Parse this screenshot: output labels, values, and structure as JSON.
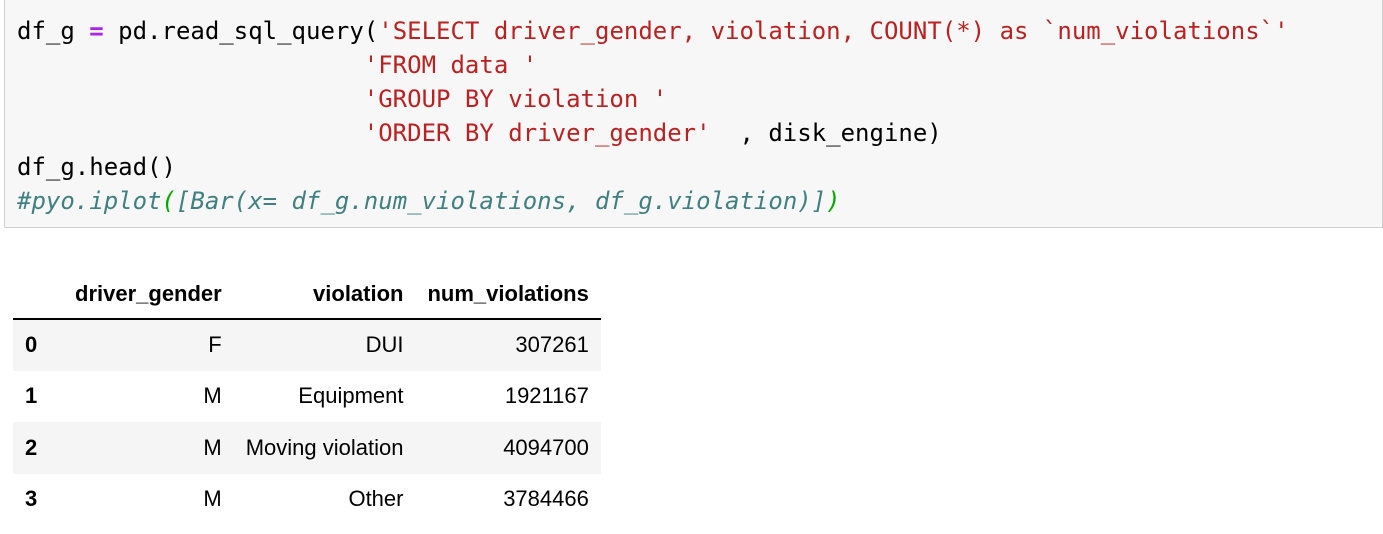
{
  "code_cell": {
    "lines": [
      {
        "parts": [
          {
            "t": "df_g ",
            "c": ""
          },
          {
            "t": "=",
            "c": "tok-op"
          },
          {
            "t": " pd.read_sql_query(",
            "c": ""
          },
          {
            "t": "'SELECT driver_gender, violation, COUNT(*) as `num_violations`'",
            "c": "tok-str"
          }
        ]
      },
      {
        "parts": [
          {
            "t": "                        ",
            "c": ""
          },
          {
            "t": "'FROM data '",
            "c": "tok-str"
          }
        ]
      },
      {
        "parts": [
          {
            "t": "                        ",
            "c": ""
          },
          {
            "t": "'GROUP BY violation '",
            "c": "tok-str"
          }
        ]
      },
      {
        "parts": [
          {
            "t": "                        ",
            "c": ""
          },
          {
            "t": "'ORDER BY driver_gender'",
            "c": "tok-str"
          },
          {
            "t": "  , disk_engine)",
            "c": ""
          }
        ]
      },
      {
        "parts": [
          {
            "t": "df_g.head()",
            "c": ""
          }
        ]
      },
      {
        "parts": [
          {
            "t": "#pyo.iplot",
            "c": "tok-comment"
          },
          {
            "t": "(",
            "c": "tok-comment tok-paren-green"
          },
          {
            "t": "[Bar(x= df_g.num_violations, df_g.violation)]",
            "c": "tok-comment"
          },
          {
            "t": ")",
            "c": "tok-comment tok-paren-green"
          }
        ]
      }
    ]
  },
  "output_table": {
    "index_header": "",
    "columns": [
      "driver_gender",
      "violation",
      "num_violations"
    ],
    "rows": [
      {
        "index": "0",
        "cells": [
          "F",
          "DUI",
          "307261"
        ]
      },
      {
        "index": "1",
        "cells": [
          "M",
          "Equipment",
          "1921167"
        ]
      },
      {
        "index": "2",
        "cells": [
          "M",
          "Moving violation",
          "4094700"
        ]
      },
      {
        "index": "3",
        "cells": [
          "M",
          "Other",
          "3784466"
        ]
      }
    ]
  },
  "colors": {
    "string": "#ba2121",
    "operator": "#aa22ff",
    "comment": "#408080",
    "cell_background": "#f7f7f7",
    "row_stripe": "#f5f5f5"
  }
}
